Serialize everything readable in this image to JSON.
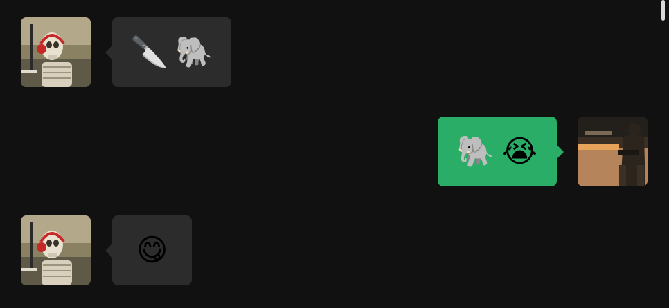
{
  "conversation": {
    "messages": [
      {
        "direction": "incoming",
        "avatar_icon": "skeleton-with-headphones",
        "content": [
          "🔪",
          "🐘"
        ]
      },
      {
        "direction": "outgoing",
        "avatar_icon": "soldier-in-desert",
        "content": [
          "🐘",
          "😭"
        ]
      },
      {
        "direction": "incoming",
        "avatar_icon": "skeleton-with-headphones",
        "content": [
          "😋"
        ]
      }
    ]
  },
  "colors": {
    "background": "#111111",
    "incoming_bubble": "#2c2c2c",
    "outgoing_bubble": "#2aae67"
  }
}
